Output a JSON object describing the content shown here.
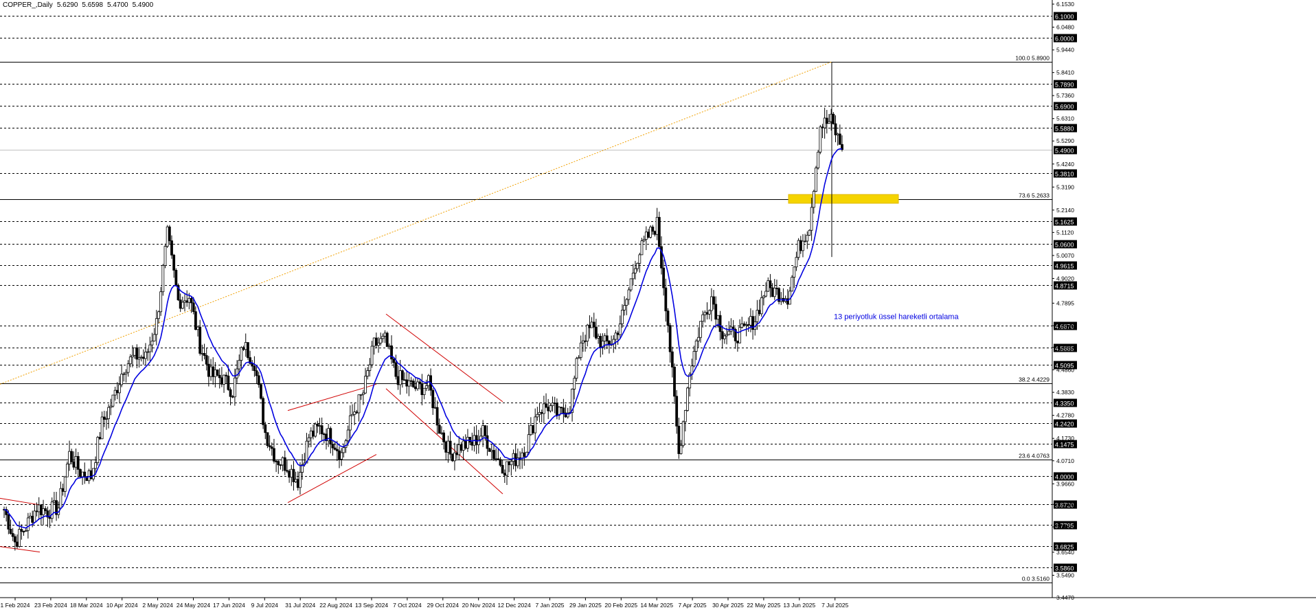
{
  "header": {
    "symbol": "COPPER_,Daily",
    "open": "5.6290",
    "high": "5.6598",
    "low": "5.4700",
    "close": "5.4900"
  },
  "chart_data": {
    "type": "candlestick",
    "symbol": "COPPER_",
    "timeframe": "Daily",
    "ylim": [
      3.447,
      6.153
    ],
    "y_ticks": [
      "6.1530",
      "6.0480",
      "5.9440",
      "5.8410",
      "5.7360",
      "5.6310",
      "5.5290",
      "5.4240",
      "5.3190",
      "5.2140",
      "5.1120",
      "5.0070",
      "4.9020",
      "4.7895",
      "4.6870",
      "4.5885",
      "4.4860",
      "4.3830",
      "4.2780",
      "4.1730",
      "4.0710",
      "3.9660",
      "3.8720",
      "3.7695",
      "3.6540",
      "3.5490",
      "3.4470"
    ],
    "x_ticks": [
      "1 Feb 2024",
      "23 Feb 2024",
      "18 Mar 2024",
      "10 Apr 2024",
      "2 May 2024",
      "24 May 2024",
      "17 Jun 2024",
      "9 Jul 2024",
      "31 Jul 2024",
      "22 Aug 2024",
      "13 Sep 2024",
      "7 Oct 2024",
      "29 Oct 2024",
      "20 Nov 2024",
      "12 Dec 2024",
      "7 Jan 2025",
      "29 Jan 2025",
      "20 Feb 2025",
      "14 Mar 2025",
      "7 Apr 2025",
      "30 Apr 2025",
      "22 May 2025",
      "13 Jun 2025",
      "7 Jul 2025"
    ],
    "highlighted_levels": [
      "6.1000",
      "6.0000",
      "5.7890",
      "5.6900",
      "5.5880",
      "5.4900",
      "5.3810",
      "5.1625",
      "5.0600",
      "4.9615",
      "4.8715",
      "4.6870",
      "4.5885",
      "4.5095",
      "4.3350",
      "4.2420",
      "4.1475",
      "4.0000",
      "3.8720",
      "3.7795",
      "3.6825",
      "3.5860"
    ],
    "fibonacci": [
      {
        "label": "100.0 5.8900",
        "value": 5.89
      },
      {
        "label": "73.6 5.2633",
        "value": 5.2633
      },
      {
        "label": "38.2 4.4229",
        "value": 4.4229
      },
      {
        "label": "23.6 4.0763",
        "value": 4.0763
      },
      {
        "label": "0.0 3.5160",
        "value": 3.516
      }
    ],
    "last_price": 5.49,
    "ema_label": "13 periyotluk üssel hareketli ortalama",
    "ema_period": 13,
    "resistance_zone": [
      5.245,
      5.285
    ],
    "series": [
      {
        "date": "1 Feb 2024",
        "close": 3.85
      },
      {
        "date": "9 Feb 2024",
        "close": 3.7
      },
      {
        "date": "16 Feb 2024",
        "close": 3.77
      },
      {
        "date": "23 Feb 2024",
        "close": 3.86
      },
      {
        "date": "1 Mar 2024",
        "close": 3.84
      },
      {
        "date": "8 Mar 2024",
        "close": 3.86
      },
      {
        "date": "15 Mar 2024",
        "close": 4.1
      },
      {
        "date": "22 Mar 2024",
        "close": 4.02
      },
      {
        "date": "29 Mar 2024",
        "close": 4.0
      },
      {
        "date": "5 Apr 2024",
        "close": 4.24
      },
      {
        "date": "12 Apr 2024",
        "close": 4.35
      },
      {
        "date": "19 Apr 2024",
        "close": 4.5
      },
      {
        "date": "26 Apr 2024",
        "close": 4.55
      },
      {
        "date": "3 May 2024",
        "close": 4.54
      },
      {
        "date": "10 May 2024",
        "close": 4.7
      },
      {
        "date": "17 May 2024",
        "close": 5.1
      },
      {
        "date": "24 May 2024",
        "close": 4.8
      },
      {
        "date": "31 May 2024",
        "close": 4.82
      },
      {
        "date": "7 Jun 2024",
        "close": 4.6
      },
      {
        "date": "14 Jun 2024",
        "close": 4.46
      },
      {
        "date": "21 Jun 2024",
        "close": 4.45
      },
      {
        "date": "28 Jun 2024",
        "close": 4.39
      },
      {
        "date": "5 Jul 2024",
        "close": 4.6
      },
      {
        "date": "12 Jul 2024",
        "close": 4.52
      },
      {
        "date": "19 Jul 2024",
        "close": 4.2
      },
      {
        "date": "26 Jul 2024",
        "close": 4.08
      },
      {
        "date": "2 Aug 2024",
        "close": 4.05
      },
      {
        "date": "9 Aug 2024",
        "close": 3.98
      },
      {
        "date": "16 Aug 2024",
        "close": 4.18
      },
      {
        "date": "23 Aug 2024",
        "close": 4.22
      },
      {
        "date": "30 Aug 2024",
        "close": 4.18
      },
      {
        "date": "6 Sep 2024",
        "close": 4.1
      },
      {
        "date": "13 Sep 2024",
        "close": 4.28
      },
      {
        "date": "20 Sep 2024",
        "close": 4.38
      },
      {
        "date": "27 Sep 2024",
        "close": 4.6
      },
      {
        "date": "4 Oct 2024",
        "close": 4.62
      },
      {
        "date": "11 Oct 2024",
        "close": 4.46
      },
      {
        "date": "18 Oct 2024",
        "close": 4.42
      },
      {
        "date": "25 Oct 2024",
        "close": 4.4
      },
      {
        "date": "1 Nov 2024",
        "close": 4.42
      },
      {
        "date": "8 Nov 2024",
        "close": 4.22
      },
      {
        "date": "15 Nov 2024",
        "close": 4.1
      },
      {
        "date": "22 Nov 2024",
        "close": 4.14
      },
      {
        "date": "29 Nov 2024",
        "close": 4.15
      },
      {
        "date": "6 Dec 2024",
        "close": 4.2
      },
      {
        "date": "13 Dec 2024",
        "close": 4.1
      },
      {
        "date": "20 Dec 2024",
        "close": 4.04
      },
      {
        "date": "27 Dec 2024",
        "close": 4.08
      },
      {
        "date": "3 Jan 2025",
        "close": 4.14
      },
      {
        "date": "10 Jan 2025",
        "close": 4.3
      },
      {
        "date": "17 Jan 2025",
        "close": 4.32
      },
      {
        "date": "24 Jan 2025",
        "close": 4.28
      },
      {
        "date": "31 Jan 2025",
        "close": 4.32
      },
      {
        "date": "7 Feb 2025",
        "close": 4.62
      },
      {
        "date": "14 Feb 2025",
        "close": 4.68
      },
      {
        "date": "21 Feb 2025",
        "close": 4.6
      },
      {
        "date": "28 Feb 2025",
        "close": 4.62
      },
      {
        "date": "7 Mar 2025",
        "close": 4.76
      },
      {
        "date": "14 Mar 2025",
        "close": 4.98
      },
      {
        "date": "21 Mar 2025",
        "close": 5.08
      },
      {
        "date": "28 Mar 2025",
        "close": 5.15
      },
      {
        "date": "4 Apr 2025",
        "close": 4.7
      },
      {
        "date": "11 Apr 2025",
        "close": 4.1
      },
      {
        "date": "18 Apr 2025",
        "close": 4.48
      },
      {
        "date": "25 Apr 2025",
        "close": 4.7
      },
      {
        "date": "2 May 2025",
        "close": 4.82
      },
      {
        "date": "9 May 2025",
        "close": 4.66
      },
      {
        "date": "16 May 2025",
        "close": 4.64
      },
      {
        "date": "23 May 2025",
        "close": 4.66
      },
      {
        "date": "30 May 2025",
        "close": 4.72
      },
      {
        "date": "6 Jun 2025",
        "close": 4.86
      },
      {
        "date": "13 Jun 2025",
        "close": 4.84
      },
      {
        "date": "20 Jun 2025",
        "close": 4.82
      },
      {
        "date": "27 Jun 2025",
        "close": 5.04
      },
      {
        "date": "4 Jul 2025",
        "close": 5.15
      },
      {
        "date": "8 Jul 2025",
        "close": 5.6
      },
      {
        "date": "11 Jul 2025",
        "close": 5.62
      },
      {
        "date": "14 Jul 2025",
        "close": 5.49
      }
    ]
  }
}
